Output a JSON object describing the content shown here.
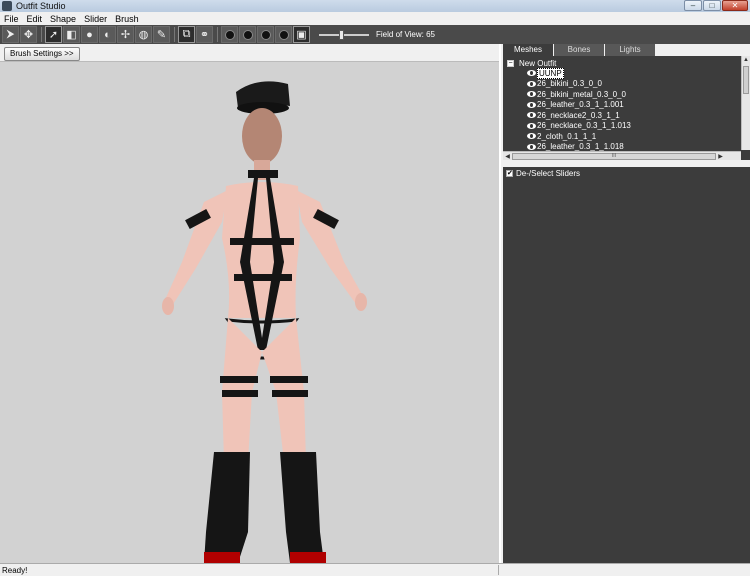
{
  "window": {
    "title": "Outfit Studio"
  },
  "window_controls": {
    "minimize": "–",
    "maximize": "□",
    "close": "✕"
  },
  "menu": [
    "File",
    "Edit",
    "Shape",
    "Slider",
    "Brush"
  ],
  "toolbar": {
    "buttons": [
      {
        "icon": "select-tool-icon"
      },
      {
        "icon": "transform-tool-icon"
      },
      {
        "icon": "standard-brush-icon"
      },
      {
        "icon": "mask-brush-icon"
      },
      {
        "icon": "inflate-brush-icon"
      },
      {
        "icon": "deflate-brush-icon"
      },
      {
        "icon": "move-brush-icon"
      },
      {
        "icon": "smooth-brush-icon"
      },
      {
        "icon": "weight-brush-icon"
      },
      {
        "icon": "color-brush-icon"
      },
      {
        "icon": "symmetry-icon"
      },
      {
        "icon": "connected-icon"
      },
      {
        "icon": "vertex-view-icon"
      },
      {
        "icon": "wireframe-view-icon"
      },
      {
        "icon": "lighting-view-icon"
      },
      {
        "icon": "texture-view-icon"
      },
      {
        "icon": "cube-view-icon"
      }
    ],
    "fov_label": "Field of View: 65",
    "fov_level": 0.45
  },
  "brush_settings_label": "Brush Settings >>",
  "tabs": [
    {
      "label": "Meshes",
      "active": true
    },
    {
      "label": "Bones",
      "active": false
    },
    {
      "label": "Lights",
      "active": false
    }
  ],
  "tree": {
    "expander": "−",
    "root": "New Outfit",
    "items": [
      "UUNP",
      "26_bikini_0.3_0_0",
      "26_bikini_metal_0.3_0_0",
      "26_leather_0.3_1_1.001",
      "26_necklace2_0.3_1_1",
      "26_necklace_0.3_1_1.013",
      "2_cloth_0.1_1_1",
      "26_leather_0.3_1_1.018"
    ]
  },
  "scroll": {
    "up": "▲",
    "down": "▼",
    "left": "◀",
    "right": "▶",
    "grip": "III"
  },
  "sliders_toggle": {
    "checked": "✔",
    "label": "De-/Select Sliders"
  },
  "status": {
    "text": "Ready!"
  },
  "colors": {
    "toolbar": "#4a4a4a",
    "panel": "#3c3c3c",
    "viewport": "#d2d2d2",
    "skin": "#f0c4b8",
    "strap": "#151515"
  }
}
